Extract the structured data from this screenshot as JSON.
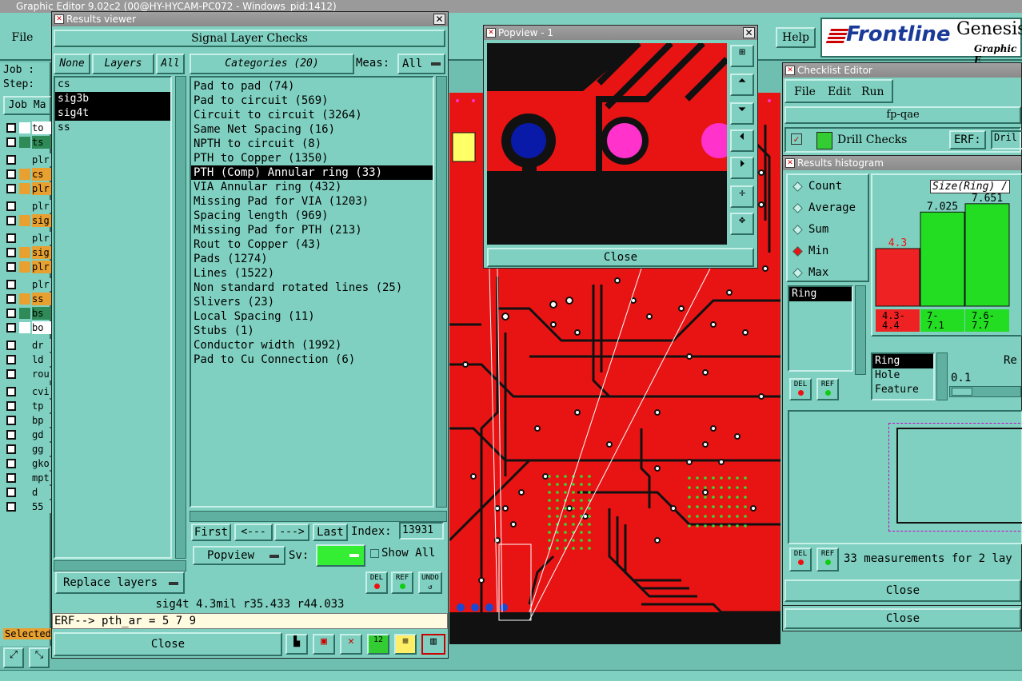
{
  "app": {
    "title": "Graphic Editor 9.02c2 (00@HY-HYCAM-PC072 - Windows_pid:1412)",
    "menu_file": "File",
    "menu_help": "Help",
    "job_label": "Job :",
    "step_label": "Step:",
    "job_matrix_label": "Job Ma",
    "selected_label": "Selected",
    "brand": "Frontline",
    "brand2": "Genesis",
    "brand3": "Graphic E"
  },
  "layer_rows": [
    {
      "name": "to",
      "color": "#ffffff"
    },
    {
      "name": "ts",
      "color": "#2e8b57"
    },
    {
      "name": "plr",
      "color": "#7fd0c0"
    },
    {
      "name": "cs",
      "color": "#e8a030"
    },
    {
      "name": "plr",
      "color": "#e8a030"
    },
    {
      "name": "plr",
      "color": "#7fd0c0"
    },
    {
      "name": "sig",
      "color": "#e8a030"
    },
    {
      "name": "plr",
      "color": "#7fd0c0"
    },
    {
      "name": "sig",
      "color": "#e8a030"
    },
    {
      "name": "plr",
      "color": "#e8a030"
    },
    {
      "name": "plr",
      "color": "#7fd0c0"
    },
    {
      "name": "ss",
      "color": "#e8a030"
    },
    {
      "name": "bs",
      "color": "#2e8b57"
    },
    {
      "name": "bo",
      "color": "#ffffff"
    },
    {
      "name": "dr",
      "color": "#7fd0c0"
    },
    {
      "name": "ld",
      "color": "#7fd0c0"
    },
    {
      "name": "rou",
      "color": "#7fd0c0"
    },
    {
      "name": "cvi",
      "color": "#7fd0c0"
    },
    {
      "name": "tp",
      "color": "#7fd0c0"
    },
    {
      "name": "bp",
      "color": "#7fd0c0"
    },
    {
      "name": "gd",
      "color": "#7fd0c0"
    },
    {
      "name": "gg",
      "color": "#7fd0c0"
    },
    {
      "name": "gko",
      "color": "#7fd0c0"
    },
    {
      "name": "mpt",
      "color": "#7fd0c0"
    },
    {
      "name": "d",
      "color": "#7fd0c0"
    },
    {
      "name": "55",
      "color": "#7fd0c0"
    }
  ],
  "results": {
    "title": "Results viewer",
    "header": "Signal Layer Checks",
    "none": "None",
    "layers": "Layers",
    "all": "All",
    "categories_btn": "Categories (20)",
    "meas_label": "Meas:",
    "meas_value": "All",
    "layer_list": [
      "cs",
      "sig3b",
      "sig4t",
      "ss"
    ],
    "selected_layers": [
      "sig3b",
      "sig4t"
    ],
    "categories": [
      "Pad to pad (74)",
      "Pad to circuit (569)",
      "Circuit to circuit (3264)",
      "Same Net Spacing (16)",
      "NPTH to circuit (8)",
      "PTH to Copper (1350)",
      "PTH (Comp) Annular ring (33)",
      "VIA Annular ring (432)",
      "Missing Pad for VIA (1203)",
      "Spacing length (969)",
      "Missing Pad for PTH (213)",
      "Rout to Copper (43)",
      "Pads (1274)",
      "Lines (1522)",
      "Non standard rotated lines (25)",
      "Slivers (23)",
      "Local Spacing (11)",
      "Stubs (1)",
      "Conductor width (1992)",
      "Pad to Cu Connection (6)"
    ],
    "selected_category": "PTH (Comp) Annular ring (33)",
    "first": "First",
    "prev": "<---",
    "next": "--->",
    "last": "Last",
    "index_label": "Index:",
    "index_value": "13931",
    "popview": "Popview",
    "sv_label": "Sv:",
    "show_all": "Show All",
    "replace_layers": "Replace layers",
    "del": "DEL",
    "ref": "REF",
    "undo": "UNDO",
    "status": "sig4t 4.3mil  r35.433  r44.033",
    "erf": "ERF--> pth_ar = 5 7 9",
    "close": "Close"
  },
  "popview": {
    "title": "Popview - 1",
    "close": "Close"
  },
  "checklist": {
    "title": "Checklist Editor",
    "menu_file": "File",
    "menu_edit": "Edit",
    "menu_run": "Run",
    "name": "fp-qae",
    "check": "Drill Checks",
    "erf_label": "ERF:",
    "erf_value": "Dril",
    "close": "Close"
  },
  "histogram": {
    "title": "Results histogram",
    "modes": [
      "Count",
      "Average",
      "Sum",
      "Min",
      "Max"
    ],
    "selected_mode": "Min",
    "chart_title": "Size(Ring) /",
    "bars": [
      {
        "label": "4.3",
        "range": "4.3-\n4.4",
        "color": "#ee2222"
      },
      {
        "label": "7.025",
        "range": "7-\n7.1",
        "color": "#22dd22"
      },
      {
        "label": "7.651",
        "range": "7.6-\n7.7",
        "color": "#22dd22"
      }
    ],
    "attr_list": [
      "Ring"
    ],
    "attr_options": [
      "Ring",
      "Hole",
      "Feature"
    ],
    "re_label": "Re",
    "re_value": "0.1",
    "del": "DEL",
    "ref": "REF",
    "measurements": "33 measurements for 2 lay",
    "close": "Close"
  },
  "chart_data": {
    "type": "bar",
    "title": "Size(Ring) /",
    "categories": [
      "4.3-4.4",
      "7-7.1",
      "7.6-7.7"
    ],
    "values": [
      4.3,
      7.025,
      7.651
    ],
    "ylim": [
      0,
      8
    ]
  }
}
